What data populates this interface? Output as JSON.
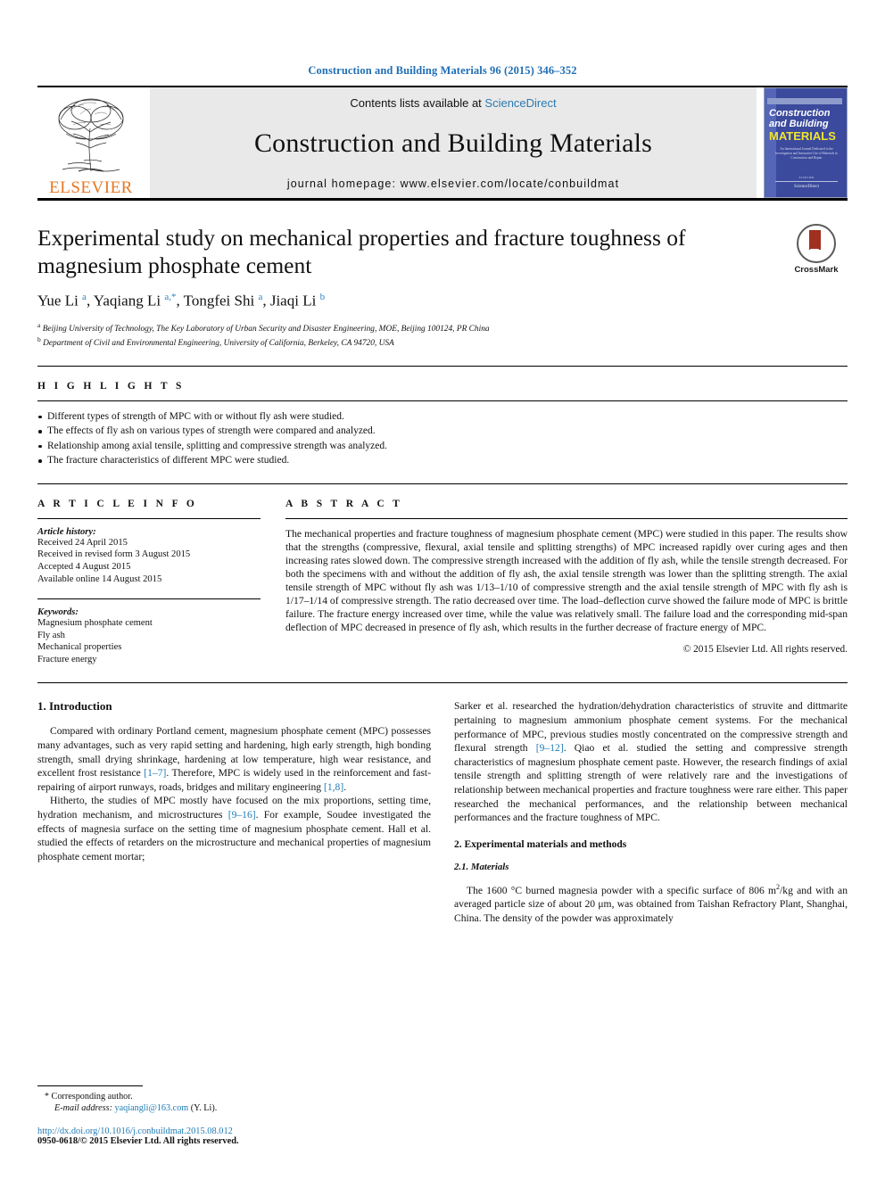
{
  "running_head": "Construction and Building Materials 96 (2015) 346–352",
  "masthead": {
    "publisher": "ELSEVIER",
    "contents_prefix": "Contents lists available at ",
    "contents_link": "ScienceDirect",
    "journal_title": "Construction and Building Materials",
    "homepage": "journal homepage: www.elsevier.com/locate/conbuildmat",
    "cover": {
      "line1": "Construction",
      "line2": "and Building",
      "line3": "MATERIALS",
      "blurb": "An International Journal Dedicated to the Investigation and Innovative Use of Materials in Construction and Repair",
      "foot_small": "ELSEVIER",
      "foot_label": "ScienceDirect"
    }
  },
  "article": {
    "title": "Experimental study on mechanical properties and fracture toughness of magnesium phosphate cement",
    "authors_html": "Yue Li <sup>a</sup>, Yaqiang Li <sup>a,*</sup>, Tongfei Shi <sup>a</sup>, Jiaqi Li <sup>b</sup>",
    "affiliations": [
      "a Beijing University of Technology, The Key Laboratory of Urban Security and Disaster Engineering, MOE, Beijing 100124, PR China",
      "b Department of Civil and Environmental Engineering, University of California, Berkeley, CA 94720, USA"
    ],
    "crossmark_label": "CrossMark"
  },
  "highlights": {
    "heading": "H I G H L I G H T S",
    "items": [
      "Different types of strength of MPC with or without fly ash were studied.",
      "The effects of fly ash on various types of strength were compared and analyzed.",
      "Relationship among axial tensile, splitting and compressive strength was analyzed.",
      "The fracture characteristics of different MPC were studied."
    ]
  },
  "article_info": {
    "heading": "A R T I C L E   I N F O",
    "history_label": "Article history:",
    "history": [
      "Received 24 April 2015",
      "Received in revised form 3 August 2015",
      "Accepted 4 August 2015",
      "Available online 14 August 2015"
    ],
    "keywords_label": "Keywords:",
    "keywords": [
      "Magnesium phosphate cement",
      "Fly ash",
      "Mechanical properties",
      "Fracture energy"
    ]
  },
  "abstract": {
    "heading": "A B S T R A C T",
    "text": "The mechanical properties and fracture toughness of magnesium phosphate cement (MPC) were studied in this paper. The results show that the strengths (compressive, flexural, axial tensile and splitting strengths) of MPC increased rapidly over curing ages and then increasing rates slowed down. The compressive strength increased with the addition of fly ash, while the tensile strength decreased. For both the specimens with and without the addition of fly ash, the axial tensile strength was lower than the splitting strength. The axial tensile strength of MPC without fly ash was 1/13–1/10 of compressive strength and the axial tensile strength of MPC with fly ash is 1/17–1/14 of compressive strength. The ratio decreased over time. The load–deflection curve showed the failure mode of MPC is brittle failure. The fracture energy increased over time, while the value was relatively small. The failure load and the corresponding mid-span deflection of MPC decreased in presence of fly ash, which results in the further decrease of fracture energy of MPC.",
    "copyright": "© 2015 Elsevier Ltd. All rights reserved."
  },
  "body": {
    "section1_heading": "1. Introduction",
    "left_p1_a": "Compared with ordinary Portland cement, magnesium phosphate cement (MPC) possesses many advantages, such as very rapid setting and hardening, high early strength, high bonding strength, small drying shrinkage, hardening at low temperature, high wear resistance, and excellent frost resistance ",
    "left_p1_ref1": "[1–7]",
    "left_p1_b": ". Therefore, MPC is widely used in the reinforcement and fast-repairing of airport runways, roads, bridges and military engineering ",
    "left_p1_ref2": "[1,8]",
    "left_p1_c": ".",
    "left_p2_a": "Hitherto, the studies of MPC mostly have focused on the mix proportions, setting time, hydration mechanism, and microstructures ",
    "left_p2_ref1": "[9–16]",
    "left_p2_b": ". For example, Soudee investigated the effects of magnesia surface on the setting time of magnesium phosphate cement. Hall et al. studied the effects of retarders on the microstructure and mechanical properties of magnesium phosphate cement mortar;",
    "right_p1_a": "Sarker et al. researched the hydration/dehydration characteristics of struvite and dittmarite pertaining to magnesium ammonium phosphate cement systems. For the mechanical performance of MPC, previous studies mostly concentrated on the compressive strength and flexural strength ",
    "right_p1_ref1": "[9–12]",
    "right_p1_b": ". Qiao et al. studied the setting and compressive strength characteristics of magnesium phosphate cement paste. However, the research findings of axial tensile strength and splitting strength of were relatively rare and the investigations of relationship between mechanical properties and fracture toughness were rare either. This paper researched the mechanical performances, and the relationship between mechanical performances and the fracture toughness of MPC.",
    "section2_heading": "2. Experimental materials and methods",
    "section21_heading": "2.1. Materials",
    "right_p2_a": "The 1600 °C burned magnesia powder with a specific surface of 806 m",
    "right_p2_sup": "2",
    "right_p2_b": "/kg and with an averaged particle size of about 20 μm, was obtained from Taishan Refractory Plant, Shanghai, China. The density of the powder was approximately"
  },
  "footnote": {
    "corresponding": "Corresponding author.",
    "email_label": "E-mail address:",
    "email": "yaqiangli@163.com",
    "email_suffix": "(Y. Li).",
    "doi": "http://dx.doi.org/10.1016/j.conbuildmat.2015.08.012",
    "issn_line": "0950-0618/© 2015 Elsevier Ltd. All rights reserved."
  },
  "colors": {
    "link_blue": "#1f7bb6",
    "elsevier_orange": "#E87722",
    "cover_blue": "#3b4a9c",
    "cover_yellow": "#f2e52a"
  }
}
